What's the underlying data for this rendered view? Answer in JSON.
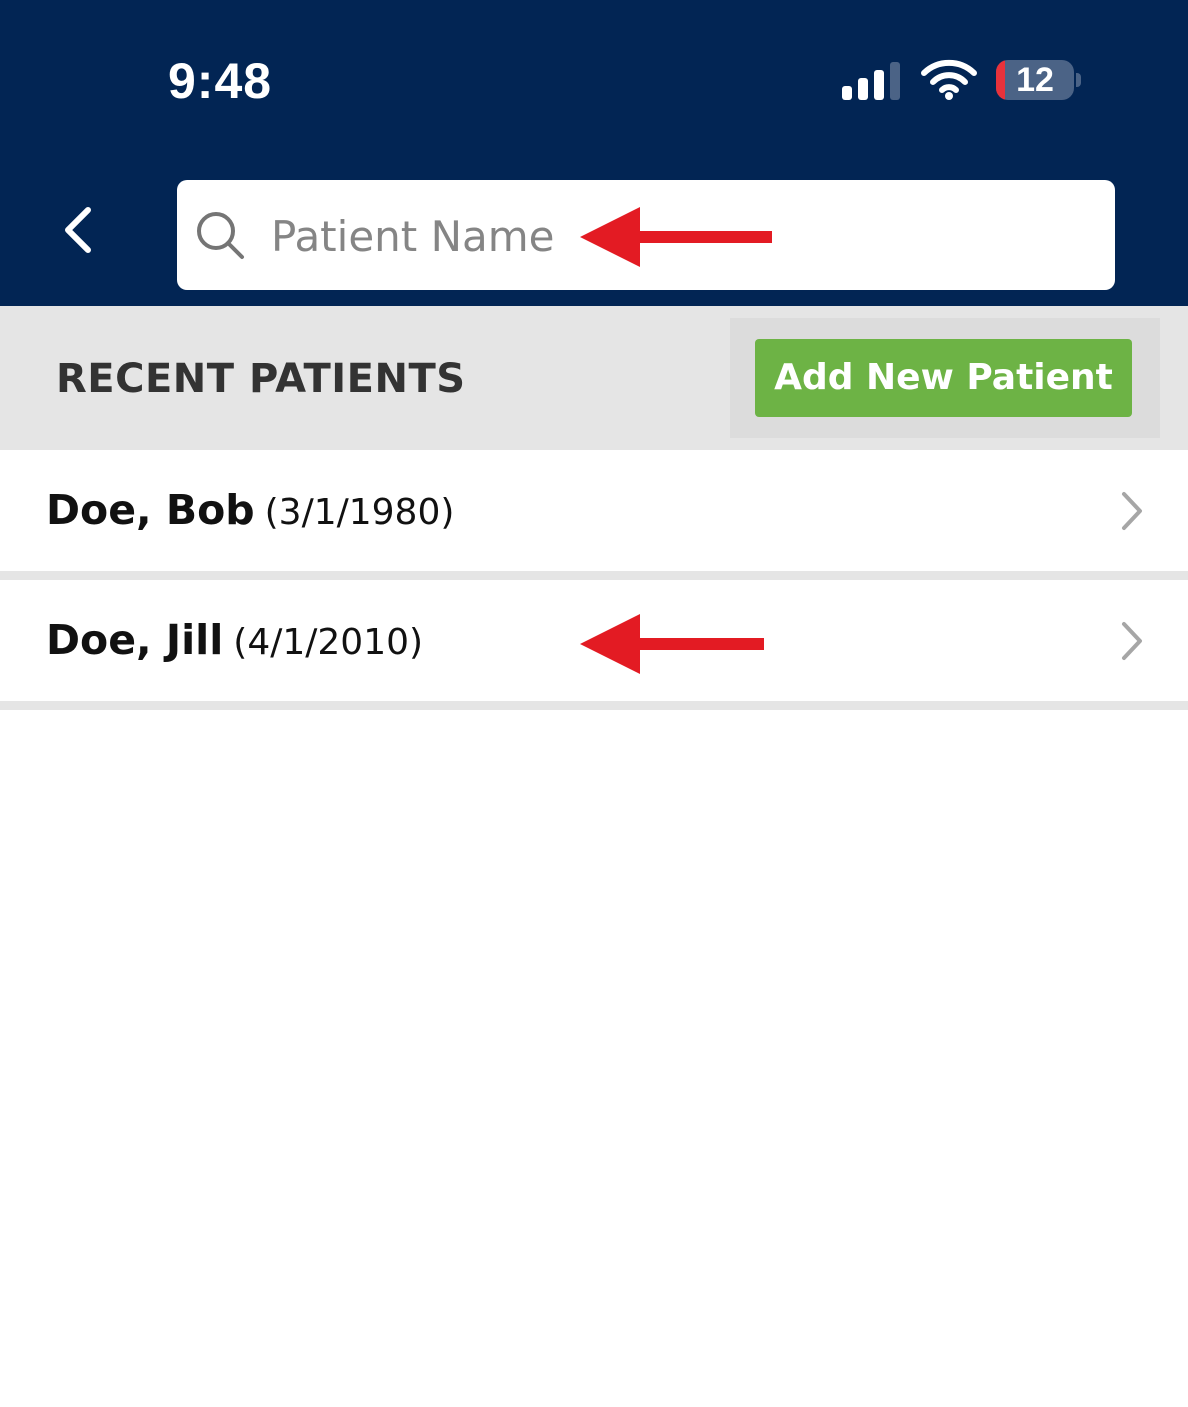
{
  "status_bar": {
    "time": "9:48",
    "battery_level": "12",
    "icons": [
      "cellular-signal-icon",
      "wifi-icon",
      "battery-icon"
    ]
  },
  "header": {
    "back_icon": "chevron-left-icon",
    "search": {
      "icon": "search-icon",
      "placeholder": "Patient Name",
      "value": ""
    }
  },
  "recent": {
    "title": "RECENT PATIENTS",
    "add_button_label": "Add New Patient",
    "patients": [
      {
        "name": "Doe, Bob",
        "dob": "(3/1/1980)"
      },
      {
        "name": "Doe, Jill",
        "dob": "(4/1/2010)"
      }
    ]
  },
  "annotations": {
    "arrow_icon": "red-arrow-left-icon",
    "color": "#e31b23"
  },
  "colors": {
    "header_bg": "#022554",
    "add_button": "#6db345",
    "section_bg": "#e5e5e5",
    "battery_low": "#e8323b"
  }
}
